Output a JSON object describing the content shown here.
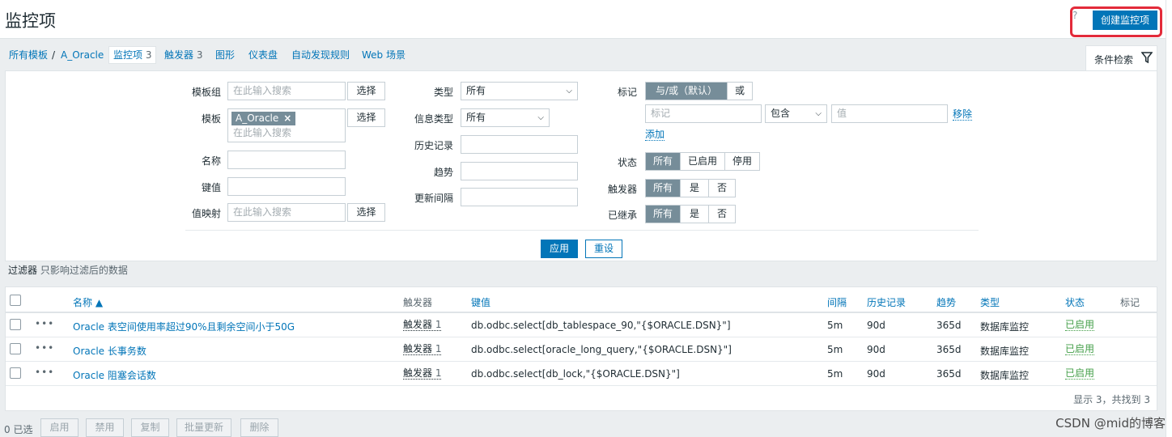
{
  "header": {
    "title": "监控项",
    "help": "?",
    "create_button": "创建监控项"
  },
  "nav": {
    "all_templates": "所有模板",
    "sep": "/",
    "template": "A_Oracle",
    "items_label": "监控项",
    "items_count": "3",
    "triggers_label": "触发器",
    "triggers_count": "3",
    "graphs": "图形",
    "dashboards": "仪表盘",
    "discovery": "自动发现规则",
    "web": "Web 场景"
  },
  "filter_tab": {
    "label": "条件检索"
  },
  "filter": {
    "template_group_label": "模板组",
    "template_group_placeholder": "在此输入搜索",
    "select_button": "选择",
    "template_label": "模板",
    "template_tag": "A_Oracle",
    "template_tag_remove": "×",
    "template_placeholder": "在此输入搜索",
    "name_label": "名称",
    "key_label": "键值",
    "valuemap_label": "值映射",
    "valuemap_placeholder": "在此输入搜索",
    "type_label": "类型",
    "type_value": "所有",
    "info_type_label": "信息类型",
    "info_type_value": "所有",
    "history_label": "历史记录",
    "trends_label": "趋势",
    "interval_label": "更新间隔",
    "tags_label": "标记",
    "tags_andor": "与/或（默认）",
    "tags_or": "或",
    "tag_name_placeholder": "标记",
    "tag_operator": "包含",
    "tag_value_placeholder": "值",
    "tag_remove": "移除",
    "tag_add": "添加",
    "state_label": "状态",
    "state_options": [
      "所有",
      "已启用",
      "停用"
    ],
    "triggers_label": "触发器",
    "triggers_options": [
      "所有",
      "是",
      "否"
    ],
    "inherited_label": "已继承",
    "inherited_options": [
      "所有",
      "是",
      "否"
    ],
    "apply": "应用",
    "reset": "重设"
  },
  "filter_note": {
    "bold": "过滤器",
    "muted": "只影响过滤后的数据"
  },
  "table": {
    "columns": {
      "name": "名称 ▲",
      "triggers": "触发器",
      "key": "键值",
      "interval": "间隔",
      "history": "历史记录",
      "trends": "趋势",
      "type": "类型",
      "status": "状态",
      "tags": "标记"
    },
    "rows": [
      {
        "dots": "•••",
        "name": "Oracle 表空间使用率超过90%且剩余空间小于50G",
        "triggers": "触发器",
        "triggers_count": "1",
        "key": "db.odbc.select[db_tablespace_90,\"{$ORACLE.DSN}\"]",
        "interval": "5m",
        "history": "90d",
        "trends": "365d",
        "type": "数据库监控",
        "status": "已启用"
      },
      {
        "dots": "•••",
        "name": "Oracle 长事务数",
        "triggers": "触发器",
        "triggers_count": "1",
        "key": "db.odbc.select[oracle_long_query,\"{$ORACLE.DSN}\"]",
        "interval": "5m",
        "history": "90d",
        "trends": "365d",
        "type": "数据库监控",
        "status": "已启用"
      },
      {
        "dots": "•••",
        "name": "Oracle 阻塞会话数",
        "triggers": "触发器",
        "triggers_count": "1",
        "key": "db.odbc.select[db_lock,\"{$ORACLE.DSN}\"]",
        "interval": "5m",
        "history": "90d",
        "trends": "365d",
        "type": "数据库监控",
        "status": "已启用"
      }
    ],
    "found": "显示 3，共找到 3"
  },
  "actions": {
    "selected": "0 已选",
    "enable": "启用",
    "disable": "禁用",
    "copy": "复制",
    "mass_update": "批量更新",
    "delete": "删除"
  },
  "watermark": "CSDN @mid的博客"
}
